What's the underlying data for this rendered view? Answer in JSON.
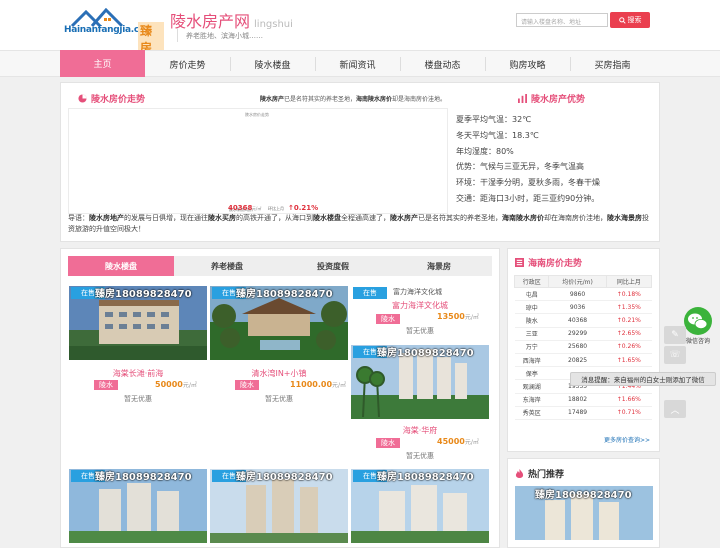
{
  "header": {
    "logo_url": "Hainanfangjia.com",
    "logo_cn": "臻房网",
    "title": "陵水房产网",
    "title_en": "lingshui",
    "tagline": "养老胜地、滨海小城……",
    "search_placeholder": "请输入楼盘名称、地址",
    "search_button": "搜索"
  },
  "nav": [
    "主页",
    "房价走势",
    "陵水楼盘",
    "新闻资讯",
    "楼盘动态",
    "购房攻略",
    "买房指南"
  ],
  "overview": {
    "price_trend_title": "陵水房价走势",
    "advantage_title": "陵水房产优势",
    "intro": {
      "a": "陵水房产",
      "b": "已是名符其实的养老圣地，",
      "c": "海南陵水房价",
      "d": "却是海南房价洼地。"
    },
    "chart": {
      "title": "陵水房价走势",
      "avg_label": "陵水新房均价",
      "avg_value": "40368",
      "avg_unit": "元/㎡",
      "mom_label": "环比上月",
      "mom_value": "↑0.21%"
    },
    "facts": [
      "夏季平均气温：32℃",
      "冬天平均气温：18.3℃",
      "年均湿度：80%",
      "优势：气候与三亚无异，冬季气温高",
      "环境：干湿季分明，夏秋多雨，冬春干燥",
      "交通：距海口3小时，距三亚约90分钟。"
    ],
    "guide": {
      "p1": "导语：",
      "b1": "陵水房地产",
      "p2": "的发展与日俱增，现在通往",
      "b2": "陵水买房",
      "p3": "的高铁开通了，从海口到",
      "b3": "陵水楼盘",
      "p4": "全程通高速了，",
      "b4": "陵水房产",
      "p5": "已是名符其实的养老圣地，",
      "b5": "海南陵水房价",
      "p6": "却在海南房价洼地，",
      "b6": "陵水海景房",
      "p7": "投资旅游的升值空间极大！"
    }
  },
  "tabs": [
    "陵水楼盘",
    "养老楼盘",
    "投资度假",
    "海景房"
  ],
  "listing": {
    "badge": "在售",
    "phone": "臻房18089828470",
    "no_discount": "暂无优惠",
    "unit": "元/㎡",
    "cards": [
      {
        "name": "海棠长滩·前海",
        "region": "陵水",
        "price": "50000"
      },
      {
        "name": "清水湾IN+小镇",
        "region": "陵水",
        "price": "11000.00"
      },
      {
        "name": "富力海洋文化城",
        "region": "陵水",
        "price": "13500"
      },
      {
        "name": "海棠·华府",
        "region": "陵水",
        "price": "45000"
      }
    ],
    "img_alt_1": "富力海洋文化城"
  },
  "price_table": {
    "title": "海南房价走势",
    "headers": [
      "行政区",
      "均价(元/m)",
      "同比上月"
    ],
    "rows": [
      [
        "屯昌",
        "9860",
        "↑0.18%"
      ],
      [
        "琼中",
        "9036",
        "↑1.35%"
      ],
      [
        "陵水",
        "40368",
        "↑0.21%"
      ],
      [
        "三亚",
        "29299",
        "↑2.65%"
      ],
      [
        "万宁",
        "25680",
        "↑0.26%"
      ],
      [
        "西海岸",
        "20825",
        "↑1.65%"
      ],
      [
        "保亭",
        "",
        ""
      ],
      [
        "观澜湖",
        "19355",
        "↑1.44%"
      ],
      [
        "东海岸",
        "18802",
        "↑1.66%"
      ],
      [
        "秀英区",
        "17489",
        "↑0.71%"
      ]
    ],
    "more": "更多房价查询>>"
  },
  "hot": {
    "title": "热门推荐"
  },
  "floating": {
    "wechat_label": "微信咨询",
    "toast": "消息提醒：来自福州的白女士刚添加了微信"
  },
  "colors": {
    "accent": "#f06d96",
    "brand_pink": "#e54f7a",
    "price_red": "#e0303c",
    "badge_blue": "#29a0e0"
  }
}
